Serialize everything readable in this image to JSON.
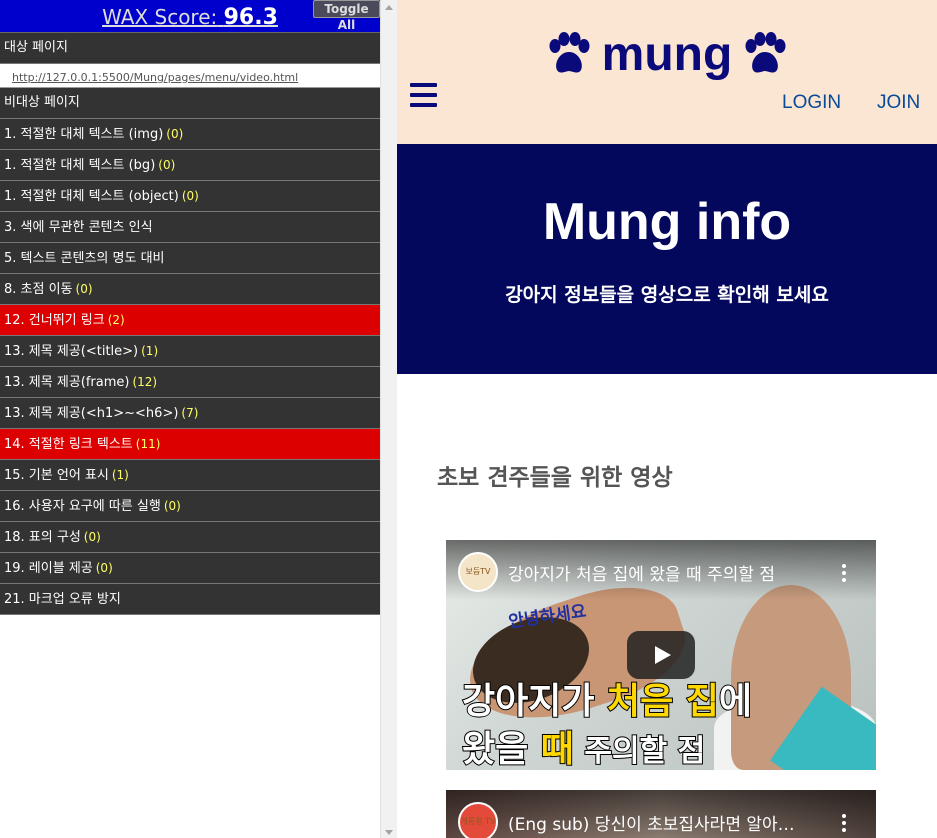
{
  "wax": {
    "score_label": "WAX Score:",
    "score_value": "96.3",
    "toggle_label": "Toggle All",
    "target_label": "대상 페이지",
    "url": "http://127.0.0.1:5500/Mung/pages/menu/video.html",
    "non_target_label": "비대상 페이지",
    "items": [
      {
        "label": "1. 적절한 대체 텍스트 (img)",
        "count": "(0)",
        "status": "pass"
      },
      {
        "label": "1. 적절한 대체 텍스트 (bg)",
        "count": "(0)",
        "status": "pass"
      },
      {
        "label": "1. 적절한 대체 텍스트 (object)",
        "count": "(0)",
        "status": "pass"
      },
      {
        "label": "3. 색에 무관한 콘텐츠 인식",
        "count": "",
        "status": "pass"
      },
      {
        "label": "5. 텍스트 콘텐츠의 명도 대비",
        "count": "",
        "status": "pass"
      },
      {
        "label": "8. 초점 이동",
        "count": "(0)",
        "status": "pass"
      },
      {
        "label": "12. 건너뛰기 링크",
        "count": "(2)",
        "status": "fail"
      },
      {
        "label": "13. 제목 제공(<title>)",
        "count": "(1)",
        "status": "pass"
      },
      {
        "label": "13. 제목 제공(frame)",
        "count": "(12)",
        "status": "pass"
      },
      {
        "label": "13. 제목 제공(<h1>~<h6>)",
        "count": "(7)",
        "status": "pass"
      },
      {
        "label": "14. 적절한 링크 텍스트",
        "count": "(11)",
        "status": "fail"
      },
      {
        "label": "15. 기본 언어 표시",
        "count": "(1)",
        "status": "pass"
      },
      {
        "label": "16. 사용자 요구에 따른 실행",
        "count": "(0)",
        "status": "pass"
      },
      {
        "label": "18. 표의 구성",
        "count": "(0)",
        "status": "pass"
      },
      {
        "label": "19. 레이블 제공",
        "count": "(0)",
        "status": "pass"
      },
      {
        "label": "21. 마크업 오류 방지",
        "count": "",
        "status": "pass"
      }
    ]
  },
  "site": {
    "logo": "mung",
    "login": "LOGIN",
    "join": "JOIN",
    "hero_title": "Mung info",
    "hero_subtitle": "강아지 정보들을 영상으로 확인해 보세요",
    "section_title": "초보 견주들을 위한 영상",
    "videos": [
      {
        "title": "강아지가 처음 집에 왔을 때 주의할 점",
        "channel": "보듬TV",
        "thumb_hello": "안녕하세요",
        "cap_a": "강아지가 ",
        "cap_b": "처음 집",
        "cap_c": "에",
        "cap_d": "왔을 ",
        "cap_e": "때",
        "cap_f": " 주의할 점"
      },
      {
        "title": "(Eng sub) 당신이 초보집사라면 알아야 할",
        "channel": "개통령 TV"
      }
    ]
  },
  "colors": {
    "wax_header": "#0000cc",
    "row_bg": "#333333",
    "row_fail": "#dd0000",
    "count_text": "#ffff66",
    "site_header_bg": "#fae6d2",
    "hero_bg": "#03085d",
    "logo_color": "#0a0a7a"
  }
}
